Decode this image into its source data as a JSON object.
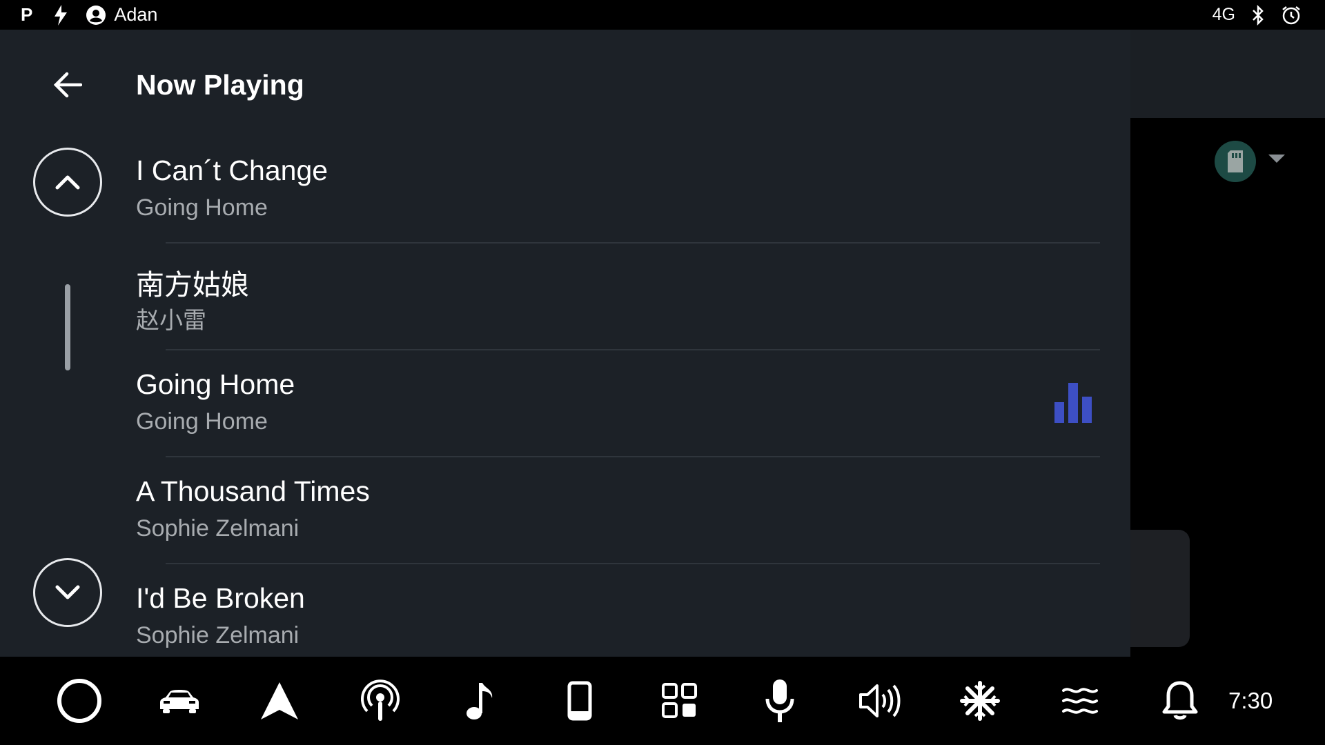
{
  "status_bar": {
    "parking_glyph": "P",
    "user_name": "Adan",
    "network": "4G",
    "icons": [
      "parking-icon",
      "charging-icon",
      "account-icon",
      "bluetooth-icon",
      "alarm-icon"
    ]
  },
  "panel": {
    "title": "Now Playing"
  },
  "tracks": [
    {
      "title": "I Can´t Change",
      "artist": "Going Home",
      "playing": false
    },
    {
      "title": "南方姑娘",
      "artist": "赵小雷",
      "playing": false
    },
    {
      "title": "Going Home",
      "artist": "Going Home",
      "playing": true
    },
    {
      "title": "A Thousand Times",
      "artist": "Sophie Zelmani",
      "playing": false
    },
    {
      "title": "I'd Be Broken",
      "artist": "Sophie Zelmani",
      "playing": false
    }
  ],
  "colors": {
    "panel_bg": "#1c2127",
    "eq_accent": "#3d4fc4",
    "source_chip": "#1d4a44"
  },
  "nav": {
    "items": [
      "home-icon",
      "car-icon",
      "navigation-icon",
      "podcast-icon",
      "music-icon",
      "phone-icon",
      "apps-icon",
      "microphone-icon",
      "volume-icon",
      "climate-icon",
      "heated-seat-icon",
      "notifications-icon"
    ],
    "clock": "7:30"
  }
}
